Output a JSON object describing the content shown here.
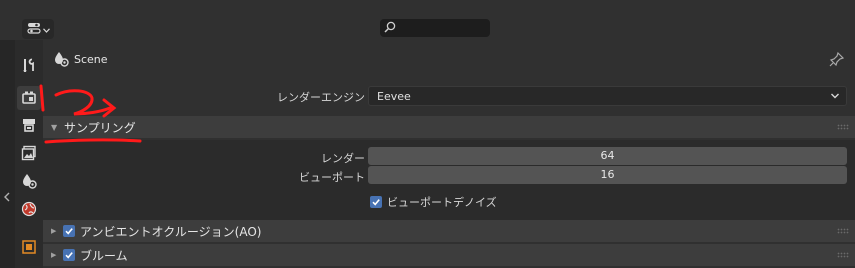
{
  "header": {
    "editor_icon": "properties-editor-icon",
    "search": {
      "placeholder": "",
      "icon": "search-icon"
    }
  },
  "sidebar": {
    "tabs": [
      {
        "name": "tool",
        "icon": "wrench-screwdriver-icon"
      },
      {
        "name": "render",
        "icon": "camera-back-icon",
        "active": true
      },
      {
        "name": "output",
        "icon": "printer-icon"
      },
      {
        "name": "view-layer",
        "icon": "image-stack-icon"
      },
      {
        "name": "scene",
        "icon": "scene-icon"
      },
      {
        "name": "world",
        "icon": "globe-icon"
      },
      {
        "name": "object",
        "icon": "object-square-icon"
      }
    ]
  },
  "context": {
    "title": "Scene",
    "pin_icon": "pin-icon"
  },
  "render_engine": {
    "label": "レンダーエンジン",
    "value": "Eevee"
  },
  "sampling": {
    "title": "サンプリング",
    "expanded": true,
    "render_label": "レンダー",
    "render_value": "64",
    "viewport_label": "ビューポート",
    "viewport_value": "16",
    "denoise_label": "ビューポートデノイズ",
    "denoise_checked": true
  },
  "panels": [
    {
      "title": "アンビエントオクルージョン(AO)",
      "checked": true,
      "expanded": false
    },
    {
      "title": "ブルーム",
      "checked": true,
      "expanded": false
    }
  ],
  "colors": {
    "accent": "#4772b3",
    "panel_bg": "#303030",
    "header_bg": "#3d3d3d",
    "annotation": "#ff1a1a"
  }
}
